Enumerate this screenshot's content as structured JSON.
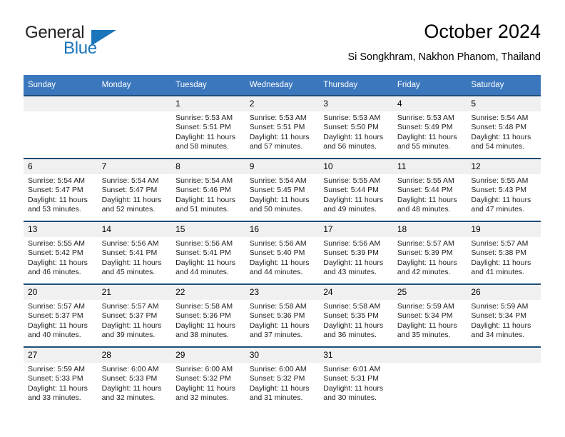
{
  "brand": {
    "name_top": "General",
    "name_bottom": "Blue",
    "accent_color": "#1b75bb"
  },
  "header": {
    "title": "October 2024",
    "subtitle": "Si Songkhram, Nakhon Phanom, Thailand"
  },
  "calendar": {
    "header_bg": "#3b77bd",
    "row_divider": "#1f4e79",
    "daynum_bg": "#f0f0f0",
    "weekdays": [
      "Sunday",
      "Monday",
      "Tuesday",
      "Wednesday",
      "Thursday",
      "Friday",
      "Saturday"
    ],
    "weeks": [
      [
        {
          "day": "",
          "lines": []
        },
        {
          "day": "",
          "lines": []
        },
        {
          "day": "1",
          "lines": [
            "Sunrise: 5:53 AM",
            "Sunset: 5:51 PM",
            "Daylight: 11 hours",
            "and 58 minutes."
          ]
        },
        {
          "day": "2",
          "lines": [
            "Sunrise: 5:53 AM",
            "Sunset: 5:51 PM",
            "Daylight: 11 hours",
            "and 57 minutes."
          ]
        },
        {
          "day": "3",
          "lines": [
            "Sunrise: 5:53 AM",
            "Sunset: 5:50 PM",
            "Daylight: 11 hours",
            "and 56 minutes."
          ]
        },
        {
          "day": "4",
          "lines": [
            "Sunrise: 5:53 AM",
            "Sunset: 5:49 PM",
            "Daylight: 11 hours",
            "and 55 minutes."
          ]
        },
        {
          "day": "5",
          "lines": [
            "Sunrise: 5:54 AM",
            "Sunset: 5:48 PM",
            "Daylight: 11 hours",
            "and 54 minutes."
          ]
        }
      ],
      [
        {
          "day": "6",
          "lines": [
            "Sunrise: 5:54 AM",
            "Sunset: 5:47 PM",
            "Daylight: 11 hours",
            "and 53 minutes."
          ]
        },
        {
          "day": "7",
          "lines": [
            "Sunrise: 5:54 AM",
            "Sunset: 5:47 PM",
            "Daylight: 11 hours",
            "and 52 minutes."
          ]
        },
        {
          "day": "8",
          "lines": [
            "Sunrise: 5:54 AM",
            "Sunset: 5:46 PM",
            "Daylight: 11 hours",
            "and 51 minutes."
          ]
        },
        {
          "day": "9",
          "lines": [
            "Sunrise: 5:54 AM",
            "Sunset: 5:45 PM",
            "Daylight: 11 hours",
            "and 50 minutes."
          ]
        },
        {
          "day": "10",
          "lines": [
            "Sunrise: 5:55 AM",
            "Sunset: 5:44 PM",
            "Daylight: 11 hours",
            "and 49 minutes."
          ]
        },
        {
          "day": "11",
          "lines": [
            "Sunrise: 5:55 AM",
            "Sunset: 5:44 PM",
            "Daylight: 11 hours",
            "and 48 minutes."
          ]
        },
        {
          "day": "12",
          "lines": [
            "Sunrise: 5:55 AM",
            "Sunset: 5:43 PM",
            "Daylight: 11 hours",
            "and 47 minutes."
          ]
        }
      ],
      [
        {
          "day": "13",
          "lines": [
            "Sunrise: 5:55 AM",
            "Sunset: 5:42 PM",
            "Daylight: 11 hours",
            "and 46 minutes."
          ]
        },
        {
          "day": "14",
          "lines": [
            "Sunrise: 5:56 AM",
            "Sunset: 5:41 PM",
            "Daylight: 11 hours",
            "and 45 minutes."
          ]
        },
        {
          "day": "15",
          "lines": [
            "Sunrise: 5:56 AM",
            "Sunset: 5:41 PM",
            "Daylight: 11 hours",
            "and 44 minutes."
          ]
        },
        {
          "day": "16",
          "lines": [
            "Sunrise: 5:56 AM",
            "Sunset: 5:40 PM",
            "Daylight: 11 hours",
            "and 44 minutes."
          ]
        },
        {
          "day": "17",
          "lines": [
            "Sunrise: 5:56 AM",
            "Sunset: 5:39 PM",
            "Daylight: 11 hours",
            "and 43 minutes."
          ]
        },
        {
          "day": "18",
          "lines": [
            "Sunrise: 5:57 AM",
            "Sunset: 5:39 PM",
            "Daylight: 11 hours",
            "and 42 minutes."
          ]
        },
        {
          "day": "19",
          "lines": [
            "Sunrise: 5:57 AM",
            "Sunset: 5:38 PM",
            "Daylight: 11 hours",
            "and 41 minutes."
          ]
        }
      ],
      [
        {
          "day": "20",
          "lines": [
            "Sunrise: 5:57 AM",
            "Sunset: 5:37 PM",
            "Daylight: 11 hours",
            "and 40 minutes."
          ]
        },
        {
          "day": "21",
          "lines": [
            "Sunrise: 5:57 AM",
            "Sunset: 5:37 PM",
            "Daylight: 11 hours",
            "and 39 minutes."
          ]
        },
        {
          "day": "22",
          "lines": [
            "Sunrise: 5:58 AM",
            "Sunset: 5:36 PM",
            "Daylight: 11 hours",
            "and 38 minutes."
          ]
        },
        {
          "day": "23",
          "lines": [
            "Sunrise: 5:58 AM",
            "Sunset: 5:36 PM",
            "Daylight: 11 hours",
            "and 37 minutes."
          ]
        },
        {
          "day": "24",
          "lines": [
            "Sunrise: 5:58 AM",
            "Sunset: 5:35 PM",
            "Daylight: 11 hours",
            "and 36 minutes."
          ]
        },
        {
          "day": "25",
          "lines": [
            "Sunrise: 5:59 AM",
            "Sunset: 5:34 PM",
            "Daylight: 11 hours",
            "and 35 minutes."
          ]
        },
        {
          "day": "26",
          "lines": [
            "Sunrise: 5:59 AM",
            "Sunset: 5:34 PM",
            "Daylight: 11 hours",
            "and 34 minutes."
          ]
        }
      ],
      [
        {
          "day": "27",
          "lines": [
            "Sunrise: 5:59 AM",
            "Sunset: 5:33 PM",
            "Daylight: 11 hours",
            "and 33 minutes."
          ]
        },
        {
          "day": "28",
          "lines": [
            "Sunrise: 6:00 AM",
            "Sunset: 5:33 PM",
            "Daylight: 11 hours",
            "and 32 minutes."
          ]
        },
        {
          "day": "29",
          "lines": [
            "Sunrise: 6:00 AM",
            "Sunset: 5:32 PM",
            "Daylight: 11 hours",
            "and 32 minutes."
          ]
        },
        {
          "day": "30",
          "lines": [
            "Sunrise: 6:00 AM",
            "Sunset: 5:32 PM",
            "Daylight: 11 hours",
            "and 31 minutes."
          ]
        },
        {
          "day": "31",
          "lines": [
            "Sunrise: 6:01 AM",
            "Sunset: 5:31 PM",
            "Daylight: 11 hours",
            "and 30 minutes."
          ]
        },
        {
          "day": "",
          "lines": []
        },
        {
          "day": "",
          "lines": []
        }
      ]
    ]
  }
}
